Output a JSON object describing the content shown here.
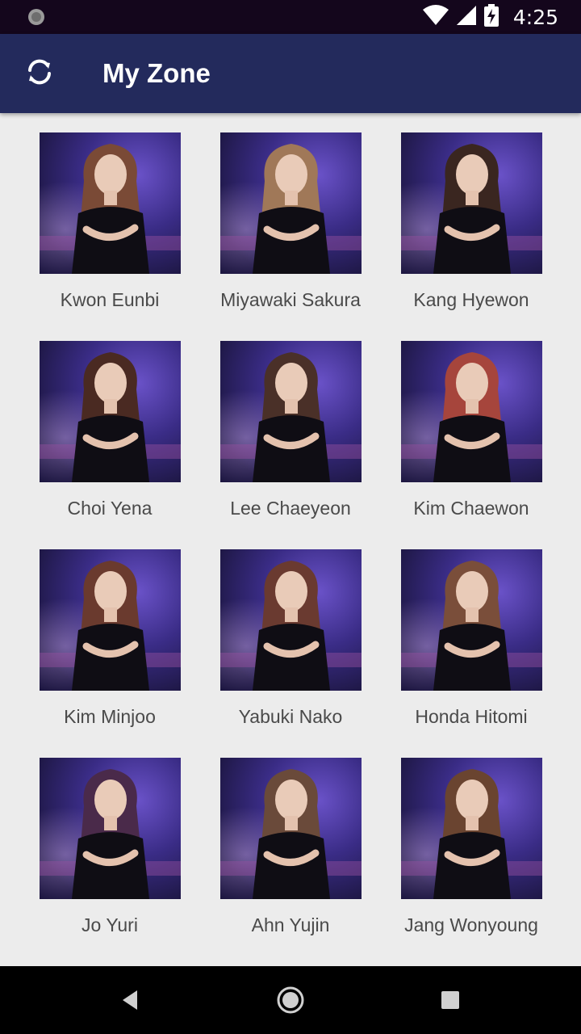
{
  "status_bar": {
    "time": "4:25",
    "icons": [
      "notification-icon",
      "wifi-icon",
      "signal-icon",
      "battery-charging-icon"
    ]
  },
  "app_bar": {
    "title": "My Zone",
    "refresh_icon": "refresh-icon"
  },
  "members": [
    {
      "name": "Kwon Eunbi",
      "hair": "#7a4a36"
    },
    {
      "name": "Miyawaki Sakura",
      "hair": "#a07858"
    },
    {
      "name": "Kang Hyewon",
      "hair": "#3a2620"
    },
    {
      "name": "Choi Yena",
      "hair": "#4a2a22"
    },
    {
      "name": "Lee Chaeyeon",
      "hair": "#4a3028"
    },
    {
      "name": "Kim Chaewon",
      "hair": "#a6453c"
    },
    {
      "name": "Kim Minjoo",
      "hair": "#6a3a2e"
    },
    {
      "name": "Yabuki Nako",
      "hair": "#6a3a30"
    },
    {
      "name": "Honda Hitomi",
      "hair": "#7a4e3a"
    },
    {
      "name": "Jo Yuri",
      "hair": "#4a2a4a"
    },
    {
      "name": "Ahn Yujin",
      "hair": "#6a4a3a"
    },
    {
      "name": "Jang Wonyoung",
      "hair": "#6a4430"
    }
  ],
  "nav_bar": {
    "back_icon": "back-icon",
    "home_icon": "home-icon",
    "recents_icon": "recents-icon"
  }
}
